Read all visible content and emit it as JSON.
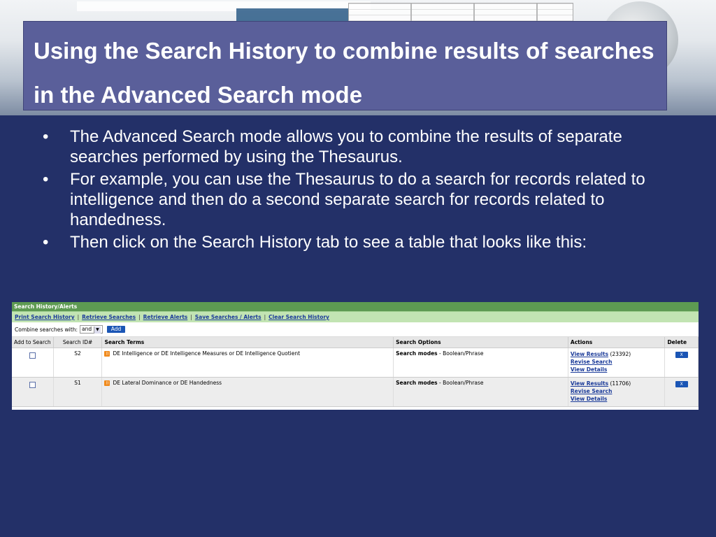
{
  "title": "Using the Search History to combine results of searches in the Advanced Search mode",
  "bullets": [
    "The Advanced Search mode allows you to combine the results of separate searches performed by using the Thesaurus.",
    "For example, you can use the Thesaurus to do a search for records related to intelligence and then do a second separate search for records related to handedness.",
    "Then click on the Search History tab to see a table that looks like this:"
  ],
  "search_history": {
    "header": "Search History/Alerts",
    "links": [
      "Print Search History",
      "Retrieve Searches",
      "Retrieve Alerts",
      "Save Searches / Alerts",
      "Clear Search History"
    ],
    "combine_label": "Combine searches with:",
    "combine_value": "and",
    "add_button": "Add",
    "columns": [
      "Add to Search",
      "Search ID#",
      "Search Terms",
      "Search Options",
      "Actions",
      "Delete"
    ],
    "rows": [
      {
        "id": "S2",
        "terms": "DE Intelligence or DE Intelligence Measures or DE Intelligence Quotient",
        "options_label": "Search modes",
        "options_value": " - Boolean/Phrase",
        "view_results": "View Results",
        "count": "(23392)",
        "revise": "Revise Search",
        "details": "View Details",
        "delete": "X"
      },
      {
        "id": "S1",
        "terms": "DE Lateral Dominance or DE Handedness",
        "options_label": "Search modes",
        "options_value": " - Boolean/Phrase",
        "view_results": "View Results",
        "count": "(11706)",
        "revise": "Revise Search",
        "details": "View Details",
        "delete": "X"
      }
    ]
  }
}
